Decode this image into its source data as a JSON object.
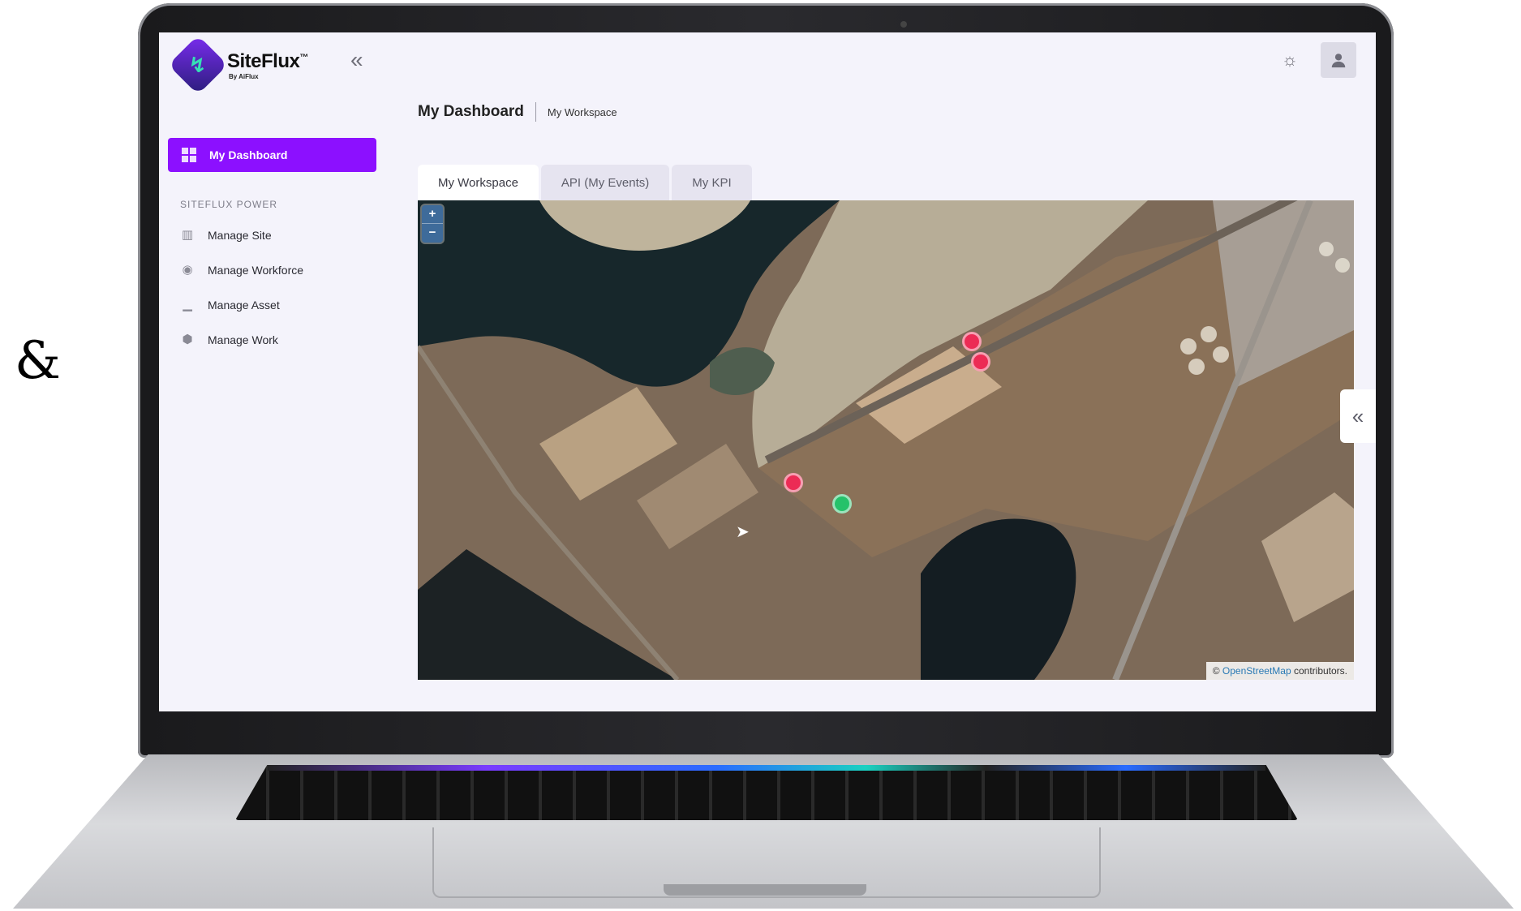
{
  "decoration": {
    "ampersand": "&"
  },
  "app": {
    "name": "SiteFlux",
    "trademark": "™",
    "byline": "By AiFlux"
  },
  "sidebar": {
    "collapse_icon": "«",
    "active_item": {
      "label": "My Dashboard",
      "icon": "dashboard-grid-icon"
    },
    "section_label": "SITEFLUX POWER",
    "items": [
      {
        "label": "Manage Site",
        "icon": "map-icon"
      },
      {
        "label": "Manage Workforce",
        "icon": "user-circle-icon"
      },
      {
        "label": "Manage Asset",
        "icon": "forklift-icon"
      },
      {
        "label": "Manage Work",
        "icon": "cube-icon"
      }
    ]
  },
  "header": {
    "title": "My Dashboard",
    "subtitle": "My Workspace"
  },
  "topbar": {
    "theme_icon": "sun-icon",
    "user_icon": "user-icon"
  },
  "tabs": [
    {
      "label": "My Workspace",
      "active": true
    },
    {
      "label": "API (My Events)",
      "active": false
    },
    {
      "label": "My KPI",
      "active": false
    }
  ],
  "map": {
    "zoom_in": "+",
    "zoom_out": "−",
    "attribution_prefix": "©",
    "attribution_link": "OpenStreetMap",
    "attribution_suffix": "contributors.",
    "markers": [
      {
        "status": "alert",
        "color": "#ec2b55"
      },
      {
        "status": "alert",
        "color": "#ec2b55"
      },
      {
        "status": "alert",
        "color": "#ec2b55"
      },
      {
        "status": "ok",
        "color": "#25c26a"
      }
    ]
  },
  "side_panel_toggle": "«",
  "colors": {
    "accent": "#8c10ff",
    "alert": "#ec2b55",
    "ok": "#25c26a"
  }
}
